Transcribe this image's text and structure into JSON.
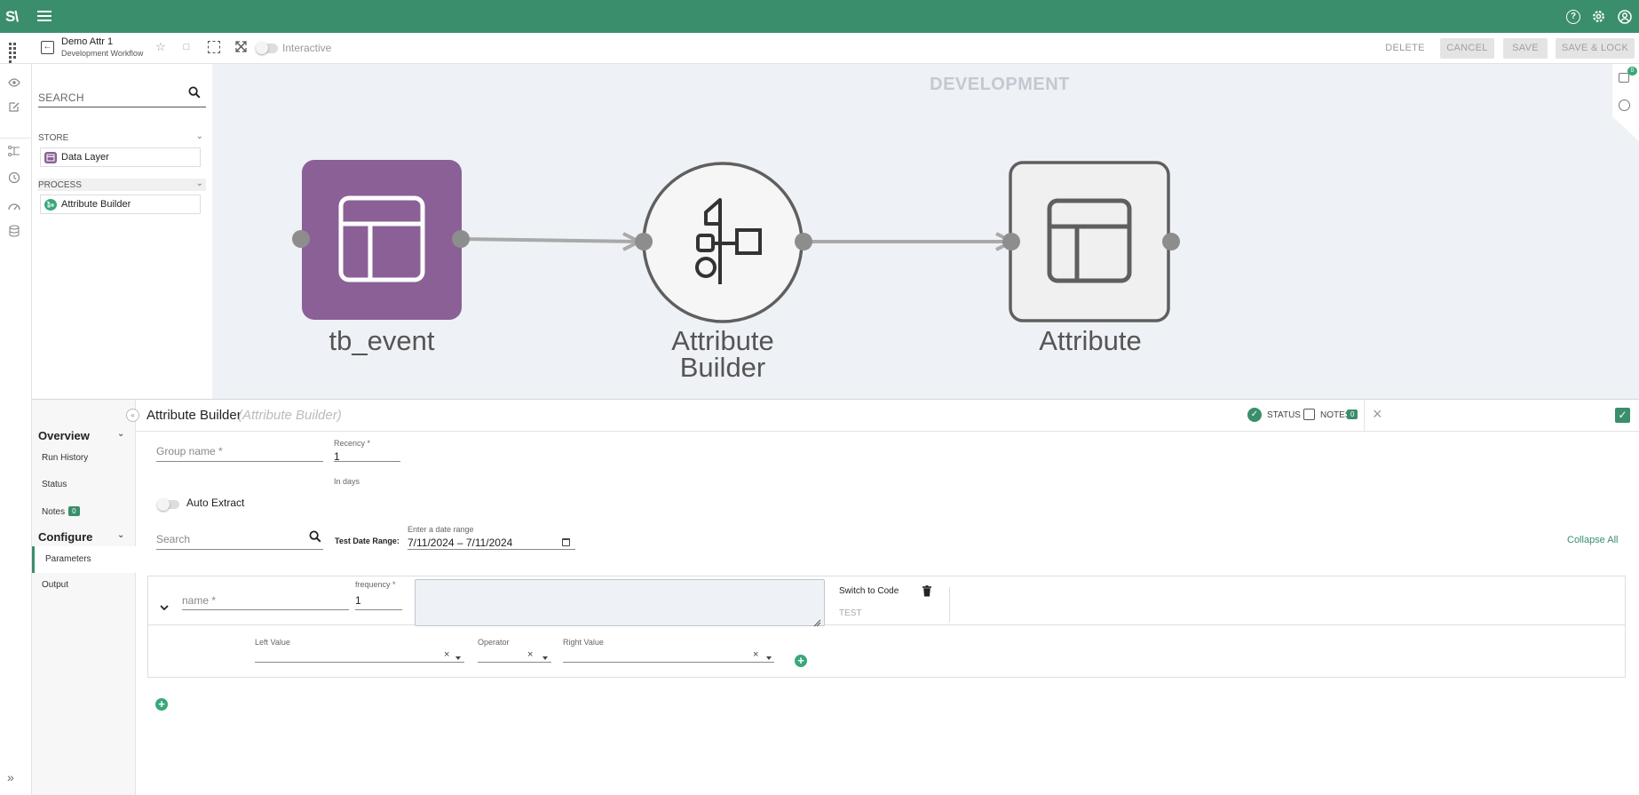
{
  "app": {
    "logo": "S\\"
  },
  "header_icons": [
    "help-icon",
    "gear-icon",
    "account-icon"
  ],
  "workflow": {
    "title": "Demo Attr 1",
    "subtitle": "Development Workflow",
    "interactive_label": "Interactive",
    "interactive_on": false
  },
  "toolbar": {
    "delete_label": "DELETE",
    "cancel_label": "CANCEL",
    "save_label": "SAVE",
    "save_lock_label": "SAVE & LOCK"
  },
  "palette": {
    "search_placeholder": "SEARCH",
    "groups": [
      {
        "label": "STORE",
        "items": [
          {
            "label": "Data Layer"
          }
        ]
      },
      {
        "label": "PROCESS",
        "items": [
          {
            "label": "Attribute Builder"
          }
        ]
      }
    ]
  },
  "canvas": {
    "environment": "DEVELOPMENT",
    "notification_count": "0",
    "nodes": [
      {
        "label_line1": "tb_event",
        "label_line2": ""
      },
      {
        "label_line1": "Attribute",
        "label_line2": "Builder"
      },
      {
        "label_line1": "Attribute",
        "label_line2": ""
      }
    ]
  },
  "colors": {
    "brand": "#3a8e6b",
    "node_purple": "#8a6096",
    "accent_green": "#3aa87a"
  },
  "sidenav": {
    "overview_label": "Overview",
    "overview_items": [
      {
        "label": "Run History"
      },
      {
        "label": "Status"
      },
      {
        "label": "Notes",
        "badge": "0"
      }
    ],
    "configure_label": "Configure",
    "configure_items": [
      {
        "label": "Parameters",
        "active": true
      },
      {
        "label": "Output"
      }
    ]
  },
  "panel": {
    "title": "Attribute Builder",
    "subtitle": "(Attribute Builder)",
    "status_label": "STATUS",
    "notes_label": "NOTES",
    "notes_count": "0"
  },
  "form": {
    "group_name_placeholder": "Group name *",
    "recency_label": "Recency *",
    "recency_value": "1",
    "recency_hint": "In days",
    "auto_extract_label": "Auto Extract",
    "search_placeholder": "Search",
    "test_date_label": "Test Date Range:",
    "date_range_label": "Enter a date range",
    "date_range_value": "7/11/2024 – 7/11/2024",
    "collapse_all_label": "Collapse All"
  },
  "attribute_row": {
    "name_placeholder": "name *",
    "frequency_label": "frequency *",
    "frequency_value": "1",
    "code_value": "",
    "switch_to_code_label": "Switch to Code",
    "test_label": "TEST"
  },
  "condition": {
    "left_label": "Left Value",
    "operator_label": "Operator",
    "right_label": "Right Value"
  }
}
